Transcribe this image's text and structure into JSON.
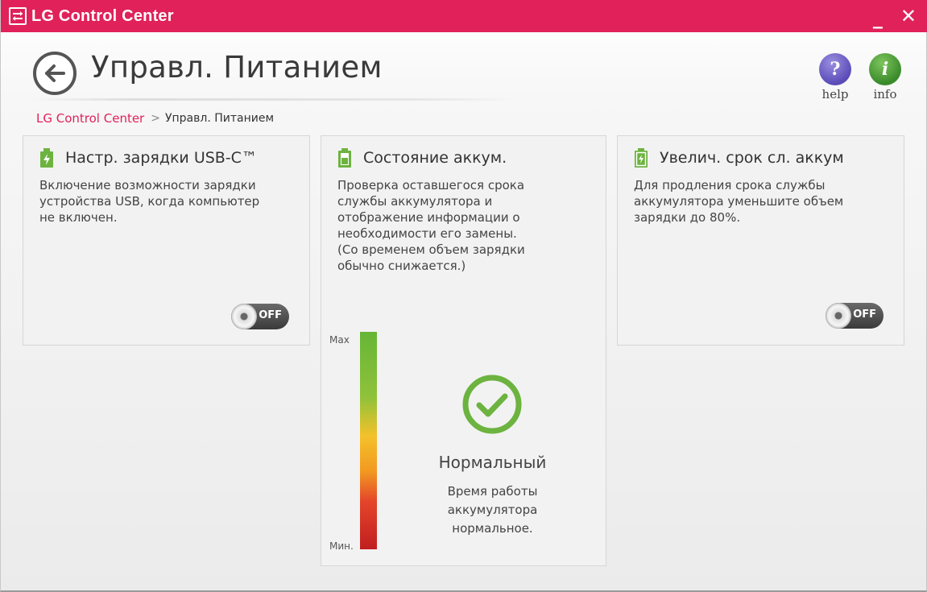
{
  "window": {
    "title": "LG Control Center",
    "minimize": "_",
    "close": "✕"
  },
  "header": {
    "title": "Управл. Питанием",
    "help_label": "help",
    "help_glyph": "?",
    "info_label": "info",
    "info_glyph": "i"
  },
  "breadcrumb": {
    "root": "LG Control Center",
    "separator": ">",
    "current": "Управл. Питанием"
  },
  "cards": {
    "usb": {
      "title": "Настр. зарядки USB-C™",
      "description": "Включение возможности зарядки\nустройства USB, когда компьютер\nне включен.",
      "toggle": "OFF"
    },
    "battery_status": {
      "title": "Состояние аккум.",
      "description": "Проверка оставшегося срока\nслужбы аккумулятора и\nотображение информации о\nнеобходимости его замены.\n (Со временем объем зарядки\nобычно снижается.)",
      "gauge_max": "Max",
      "gauge_min": "Мин.",
      "status_title": "Нормальный",
      "status_desc": "Время работы\nаккумулятора\nнормальное."
    },
    "extend_life": {
      "title": "Увелич. срок сл. аккум",
      "description": "Для продления срока службы\nаккумулятора уменьшите объем\nзарядки до 80%.",
      "toggle": "OFF"
    }
  },
  "colors": {
    "titlebar": "#e0215a",
    "accent": "#e0215a",
    "check_green": "#6cb33f"
  }
}
